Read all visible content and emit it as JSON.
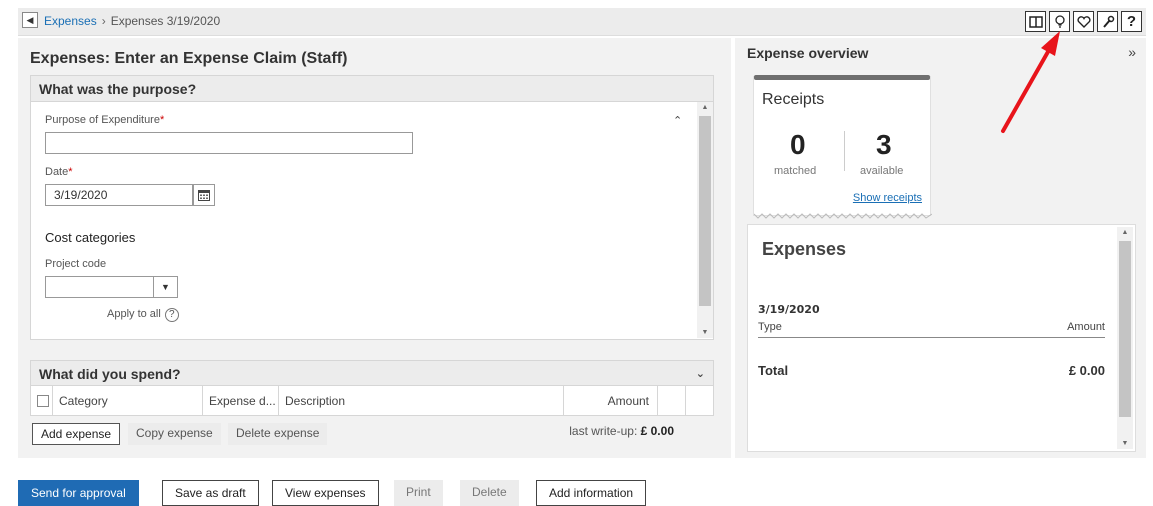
{
  "breadcrumb": {
    "root": "Expenses",
    "separator": "›",
    "current": "Expenses 3/19/2020"
  },
  "toolbar_icons": [
    "panel-icon",
    "lightbulb-icon",
    "heart-icon",
    "wrench-icon",
    "help-icon"
  ],
  "toolbar_help_glyph": "?",
  "page": {
    "title": "Expenses: Enter an Expense Claim (Staff)"
  },
  "purpose_section": {
    "title": "What was the purpose?",
    "purpose_label": "Purpose of Expenditure",
    "purpose_value": "",
    "date_label": "Date",
    "date_value": "3/19/2020",
    "required_mark": "*",
    "cost_categories_label": "Cost categories",
    "project_code_label": "Project code",
    "project_code_value": "",
    "apply_to_all_label": "Apply to all",
    "help_glyph": "?"
  },
  "spend_section": {
    "title": "What did you spend?",
    "columns": [
      "Category",
      "Expense d...",
      "Description",
      "Amount"
    ],
    "add_expense_label": "Add expense",
    "copy_expense_label": "Copy expense",
    "delete_expense_label": "Delete expense",
    "last_writeup_label": "last write-up:",
    "last_writeup_value": "£ 0.00"
  },
  "overview": {
    "title": "Expense overview",
    "expand_glyph": "»",
    "receipts": {
      "title": "Receipts",
      "matched_count": "0",
      "matched_label": "matched",
      "available_count": "3",
      "available_label": "available",
      "show_receipts_label": "Show receipts"
    },
    "expenses": {
      "title": "Expenses",
      "date": "3/19/2020",
      "type_header": "Type",
      "amount_header": "Amount",
      "total_label": "Total",
      "total_value": "£ 0.00"
    }
  },
  "bottom_buttons": {
    "send_for_approval": "Send for approval",
    "save_as_draft": "Save as draft",
    "view_expenses": "View expenses",
    "print": "Print",
    "delete": "Delete",
    "add_information": "Add information"
  },
  "colors": {
    "primary": "#1f6bb4",
    "link": "#1a6fb5",
    "required": "#cc0000",
    "annotation_arrow": "#e8141b"
  }
}
